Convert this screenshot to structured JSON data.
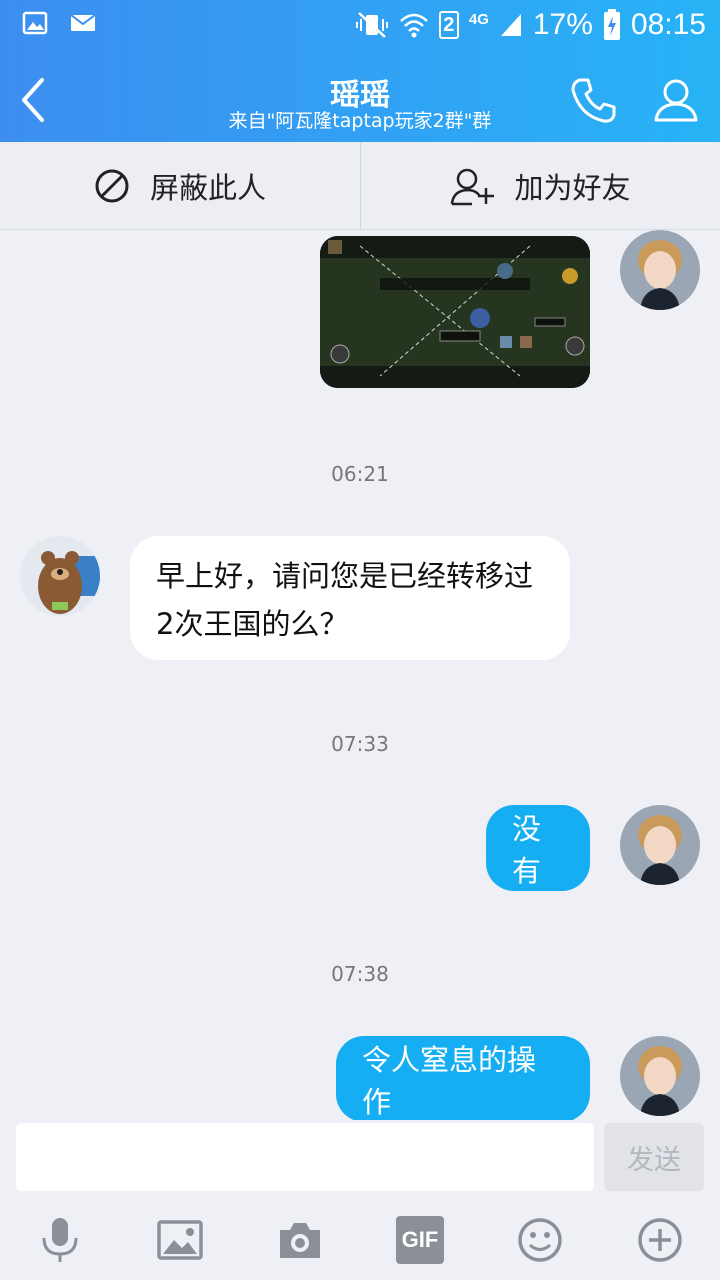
{
  "status_bar": {
    "battery": "17%",
    "time": "08:15",
    "network": "4G",
    "sim_slot": "2"
  },
  "header": {
    "title": "瑶瑶",
    "subtitle": "来自\"阿瓦隆taptap玩家2群\"群"
  },
  "actions": {
    "block_label": "屏蔽此人",
    "add_friend_label": "加为好友"
  },
  "messages": [
    {
      "type": "image",
      "direction": "out"
    },
    {
      "type": "time",
      "text": "06:21"
    },
    {
      "type": "text",
      "direction": "in",
      "line1": "早上好，请问您是已经转移过",
      "line2": "2次王国的么？"
    },
    {
      "type": "time",
      "text": "07:33"
    },
    {
      "type": "text",
      "direction": "out",
      "text": "没有"
    },
    {
      "type": "time",
      "text": "07:38"
    },
    {
      "type": "text",
      "direction": "out",
      "text": "令人窒息的操作"
    }
  ],
  "input": {
    "value": "",
    "send_label": "发送"
  },
  "toolbar": {
    "gif_label": "GIF",
    "icons": [
      "microphone-icon",
      "image-icon",
      "camera-icon",
      "gif-icon",
      "emoji-icon",
      "plus-icon"
    ]
  },
  "colors": {
    "header_start": "#3d8ef0",
    "header_end": "#27b3f6",
    "bubble_out": "#15aef3",
    "bubble_in": "#ffffff",
    "background": "#eef0f6"
  }
}
